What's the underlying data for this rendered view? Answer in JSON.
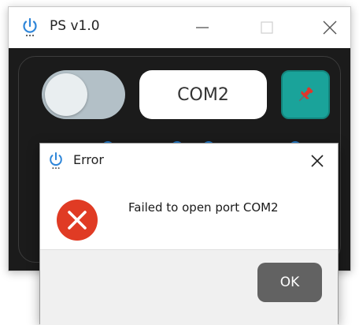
{
  "window": {
    "title": "PS v1.0",
    "icon": "power-icon"
  },
  "controls": {
    "toggle_state": "off",
    "port": "COM2",
    "pin_icon": "pushpin-icon"
  },
  "dialog": {
    "title": "Error",
    "icon": "power-icon",
    "message": "Failed to open port COM2",
    "message_icon": "error-icon",
    "ok_label": "OK"
  },
  "colors": {
    "accent": "#1aa39a",
    "panel_bg": "#1b1b1b",
    "error_red": "#e03b24",
    "button_dark": "#626262",
    "power_icon_blue": "#2f86d9"
  }
}
